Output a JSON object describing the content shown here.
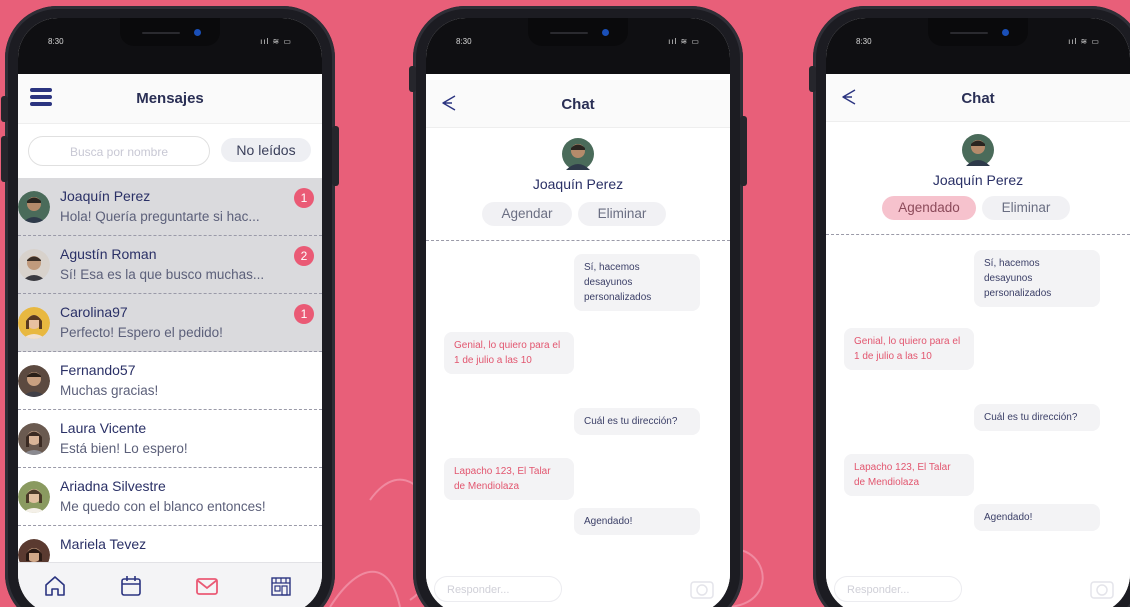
{
  "status": {
    "time": "8:30",
    "signal": "ııl ≋ ▭"
  },
  "inbox": {
    "title": "Mensajes",
    "search_placeholder": "Busca por nombre",
    "filter_label": "No leídos",
    "contacts": [
      {
        "name": "Joaquín Perez",
        "message": "Hola! Quería preguntarte si hac...",
        "unread": "1",
        "avatar_color": "#4a6b5a"
      },
      {
        "name": "Agustín Roman",
        "message": "Sí! Esa es la que busco muchas...",
        "unread": "2",
        "avatar_color": "#7a5d4a"
      },
      {
        "name": "Carolina97",
        "message": "Perfecto! Espero el pedido!",
        "unread": "1",
        "avatar_color": "#e8b840"
      },
      {
        "name": "Fernando57",
        "message": "Muchas gracias!",
        "unread": "",
        "avatar_color": "#5c4a40"
      },
      {
        "name": "Laura Vicente",
        "message": "Está bien! Lo espero!",
        "unread": "",
        "avatar_color": "#6a5a50"
      },
      {
        "name": "Ariadna Silvestre",
        "message": "Me quedo con el blanco entonces!",
        "unread": "",
        "avatar_color": "#8a9a60"
      },
      {
        "name": "Mariela Tevez",
        "message": "",
        "unread": "",
        "avatar_color": "#5a3a30"
      }
    ],
    "tabs": [
      "home-icon",
      "calendar-icon",
      "mail-icon",
      "store-icon"
    ],
    "active_tab": "mail-icon"
  },
  "chat1": {
    "title": "Chat",
    "contact_name": "Joaquín Perez",
    "action_schedule": "Agendar",
    "action_delete": "Eliminar",
    "messages": [
      {
        "from": "me",
        "text": "Sí, hacemos desayunos personalizados"
      },
      {
        "from": "them",
        "text": "Genial, lo quiero para el 1 de julio a las 10"
      },
      {
        "from": "me",
        "text": "Cuál es tu dirección?"
      },
      {
        "from": "them",
        "text": "Lapacho 123, El Talar de Mendiolaza"
      },
      {
        "from": "me",
        "text": "Agendado!"
      }
    ],
    "reply_placeholder": "Responder..."
  },
  "chat2": {
    "title": "Chat",
    "contact_name": "Joaquín Perez",
    "action_schedule": "Agendado",
    "action_delete": "Eliminar",
    "messages": [
      {
        "from": "me",
        "text": "Sí, hacemos desayunos personalizados"
      },
      {
        "from": "them",
        "text": "Genial, lo quiero para el 1 de julio a las 10"
      },
      {
        "from": "me",
        "text": "Cuál es tu dirección?"
      },
      {
        "from": "them",
        "text": "Lapacho 123, El Talar de Mendiolaza"
      },
      {
        "from": "me",
        "text": "Agendado!"
      }
    ],
    "reply_placeholder": "Responder..."
  },
  "colors": {
    "background": "#e85f79",
    "accent": "#ea5a75",
    "navy": "#2b3480"
  }
}
